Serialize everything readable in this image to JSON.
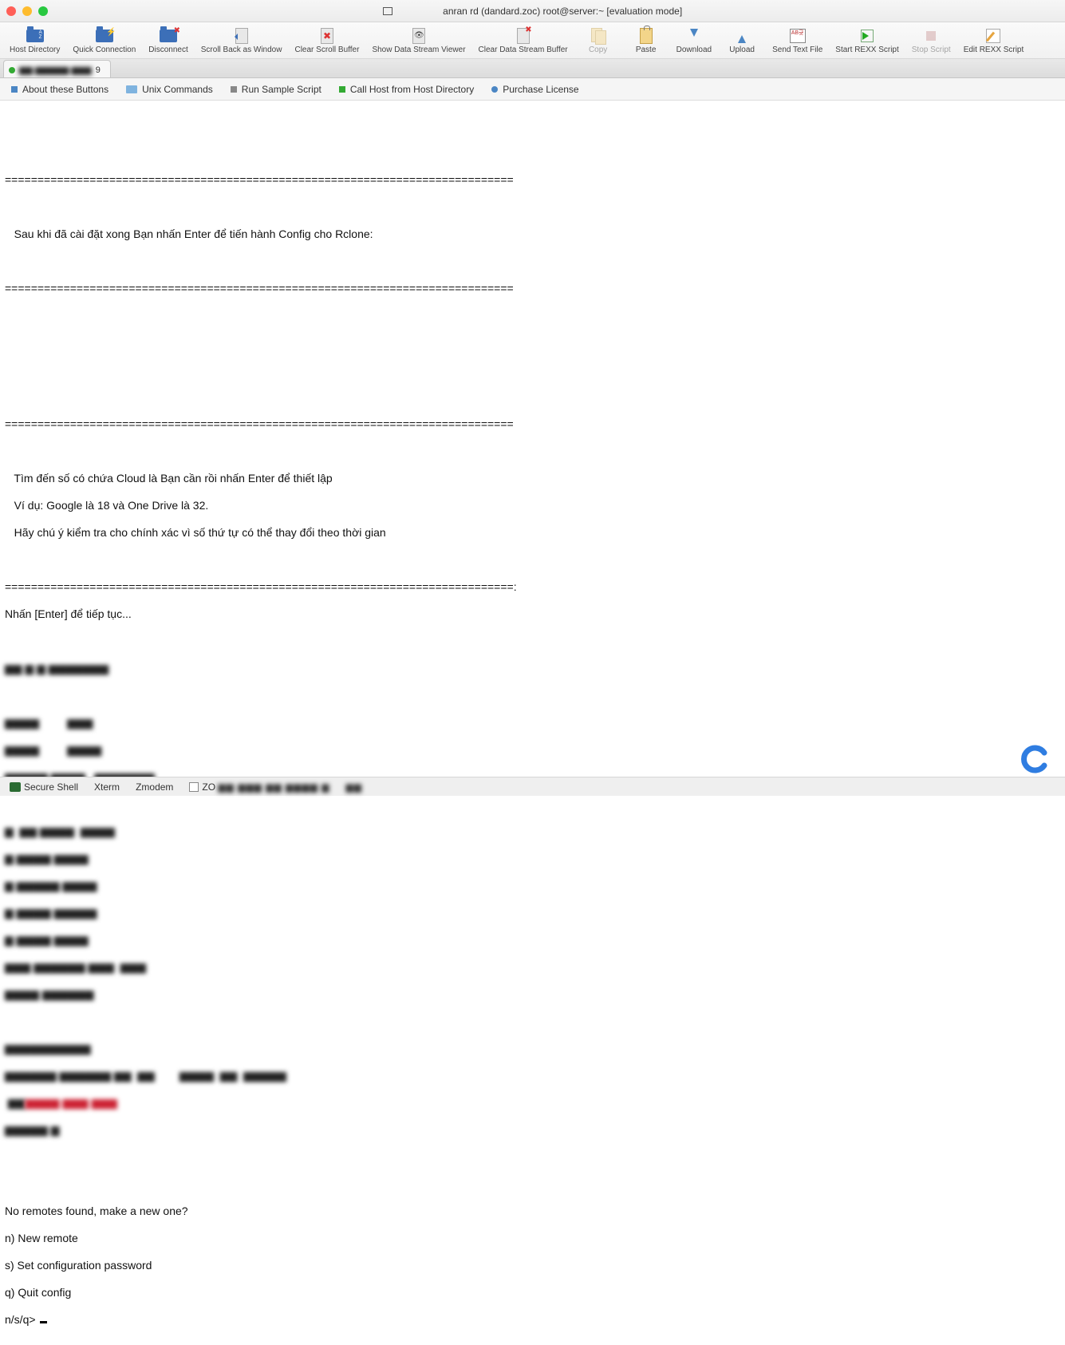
{
  "window": {
    "title": "anran rd (dandard.zoc) root@server:~ [evaluation mode]"
  },
  "toolbar": [
    {
      "label": "Host Directory",
      "icon": "folder-az",
      "enabled": true
    },
    {
      "label": "Quick Connection",
      "icon": "folder-bolt",
      "enabled": true
    },
    {
      "label": "Disconnect",
      "icon": "folder-redx",
      "enabled": true
    },
    {
      "label": "Scroll Back as Window",
      "icon": "doc-arrow",
      "enabled": true
    },
    {
      "label": "Clear Scroll Buffer",
      "icon": "doc-redx",
      "enabled": true
    },
    {
      "label": "Show Data Stream Viewer",
      "icon": "doc-eye",
      "enabled": true
    },
    {
      "label": "Clear Data Stream Buffer",
      "icon": "doc-redx2",
      "enabled": true
    },
    {
      "label": "Copy",
      "icon": "docs",
      "enabled": false
    },
    {
      "label": "Paste",
      "icon": "clip",
      "enabled": true
    },
    {
      "label": "Download",
      "icon": "arrow-down",
      "enabled": true
    },
    {
      "label": "Upload",
      "icon": "arrow-up",
      "enabled": true
    },
    {
      "label": "Send Text File",
      "icon": "txt",
      "enabled": true
    },
    {
      "label": "Start REXX Script",
      "icon": "play",
      "enabled": true
    },
    {
      "label": "Stop Script",
      "icon": "stop",
      "enabled": false
    },
    {
      "label": "Edit REXX Script",
      "icon": "edit",
      "enabled": true
    }
  ],
  "tab": {
    "label": "9"
  },
  "button_bar": [
    {
      "bullet": "blue",
      "label": "About these Buttons"
    },
    {
      "bullet": "folder",
      "label": "Unix Commands"
    },
    {
      "bullet": "gray",
      "label": "Run Sample Script"
    },
    {
      "bullet": "green",
      "label": "Call Host from Host Directory"
    },
    {
      "bullet": "bluec",
      "label": "Purchase License"
    }
  ],
  "terminal": {
    "divider": "==============================================================================",
    "divider_colon": "==============================================================================:",
    "msg1": "   Sau khi đã cài đặt xong Bạn nhấn Enter để tiến hành Config cho Rclone:",
    "msg2a": "   Tìm đến số có chứa Cloud là Bạn cần rồi nhấn Enter để thiết lập",
    "msg2b": "   Ví dụ: Google là 18 và One Drive là 32.",
    "msg2c": "   Hãy chú ý kiểm tra cho chính xác vì số thứ tự có thể thay đổi theo thời gian",
    "press_enter": "Nhấn [Enter] để tiếp tục...",
    "noremotes": "No remotes found, make a new one?",
    "opt_n": "n) New remote",
    "opt_s": "s) Set configuration password",
    "opt_q": "q) Quit config",
    "prompt": "n/s/q> "
  },
  "status": {
    "item1": "Secure Shell",
    "item2": "Xterm",
    "item3": "Zmodem",
    "zo": "ZO"
  }
}
